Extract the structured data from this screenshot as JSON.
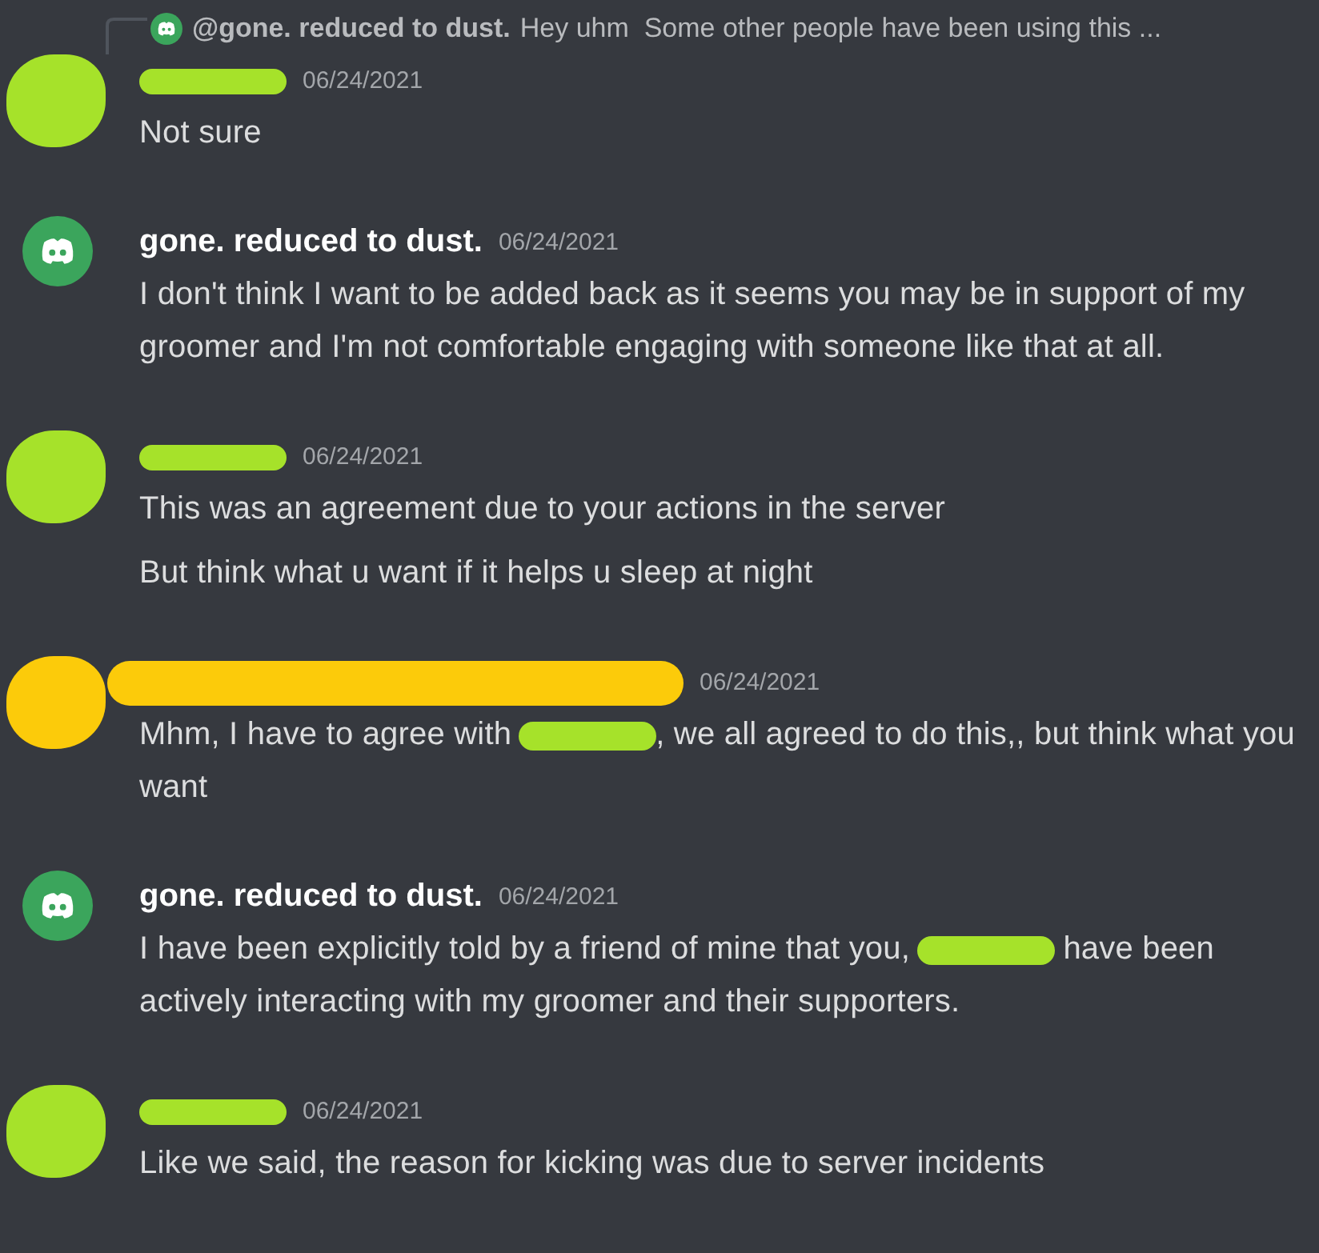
{
  "reply": {
    "author": "@gone. reduced to dust.",
    "preview": "Hey uhm  Some other people have been using this ..."
  },
  "messages": [
    {
      "kind": "redacted",
      "color": "#a6e22a",
      "timestamp": "06/24/2021",
      "paragraphs": [
        [
          {
            "kind": "text",
            "text": "Not sure"
          }
        ]
      ]
    },
    {
      "kind": "user",
      "author": "gone. reduced to dust.",
      "timestamp": "06/24/2021",
      "paragraphs": [
        [
          {
            "kind": "text",
            "text": "I don't think I want to be added back as it seems you may be in support of my groomer and I'm not comfortable engaging with someone like that at all."
          }
        ]
      ]
    },
    {
      "kind": "redacted",
      "color": "#a6e22a",
      "timestamp": "06/24/2021",
      "paragraphs": [
        [
          {
            "kind": "text",
            "text": "This was an agreement due to your actions in the server"
          }
        ],
        [
          {
            "kind": "text",
            "text": "But think what u want if it helps u sleep at night"
          }
        ]
      ]
    },
    {
      "kind": "redacted",
      "color": "#fccb0a",
      "timestamp": "06/24/2021",
      "paragraphs": [
        [
          {
            "kind": "text",
            "text": "Mhm, I have to agree with"
          },
          {
            "kind": "redaction",
            "color": "#a6e22a"
          },
          {
            "kind": "text",
            "text": ", we all agreed to do this,, but think what you want"
          }
        ]
      ]
    },
    {
      "kind": "user",
      "author": "gone. reduced to dust.",
      "timestamp": "06/24/2021",
      "paragraphs": [
        [
          {
            "kind": "text",
            "text": "I have been explicitly told by a friend of mine that you,"
          },
          {
            "kind": "redaction",
            "color": "#a6e22a"
          },
          {
            "kind": "text",
            "text": " have been actively interacting with my groomer and their supporters."
          }
        ]
      ]
    },
    {
      "kind": "redacted",
      "color": "#a6e22a",
      "timestamp": "06/24/2021",
      "paragraphs": [
        [
          {
            "kind": "text",
            "text": "Like we said, the reason for kicking was due to server incidents"
          }
        ]
      ]
    }
  ]
}
